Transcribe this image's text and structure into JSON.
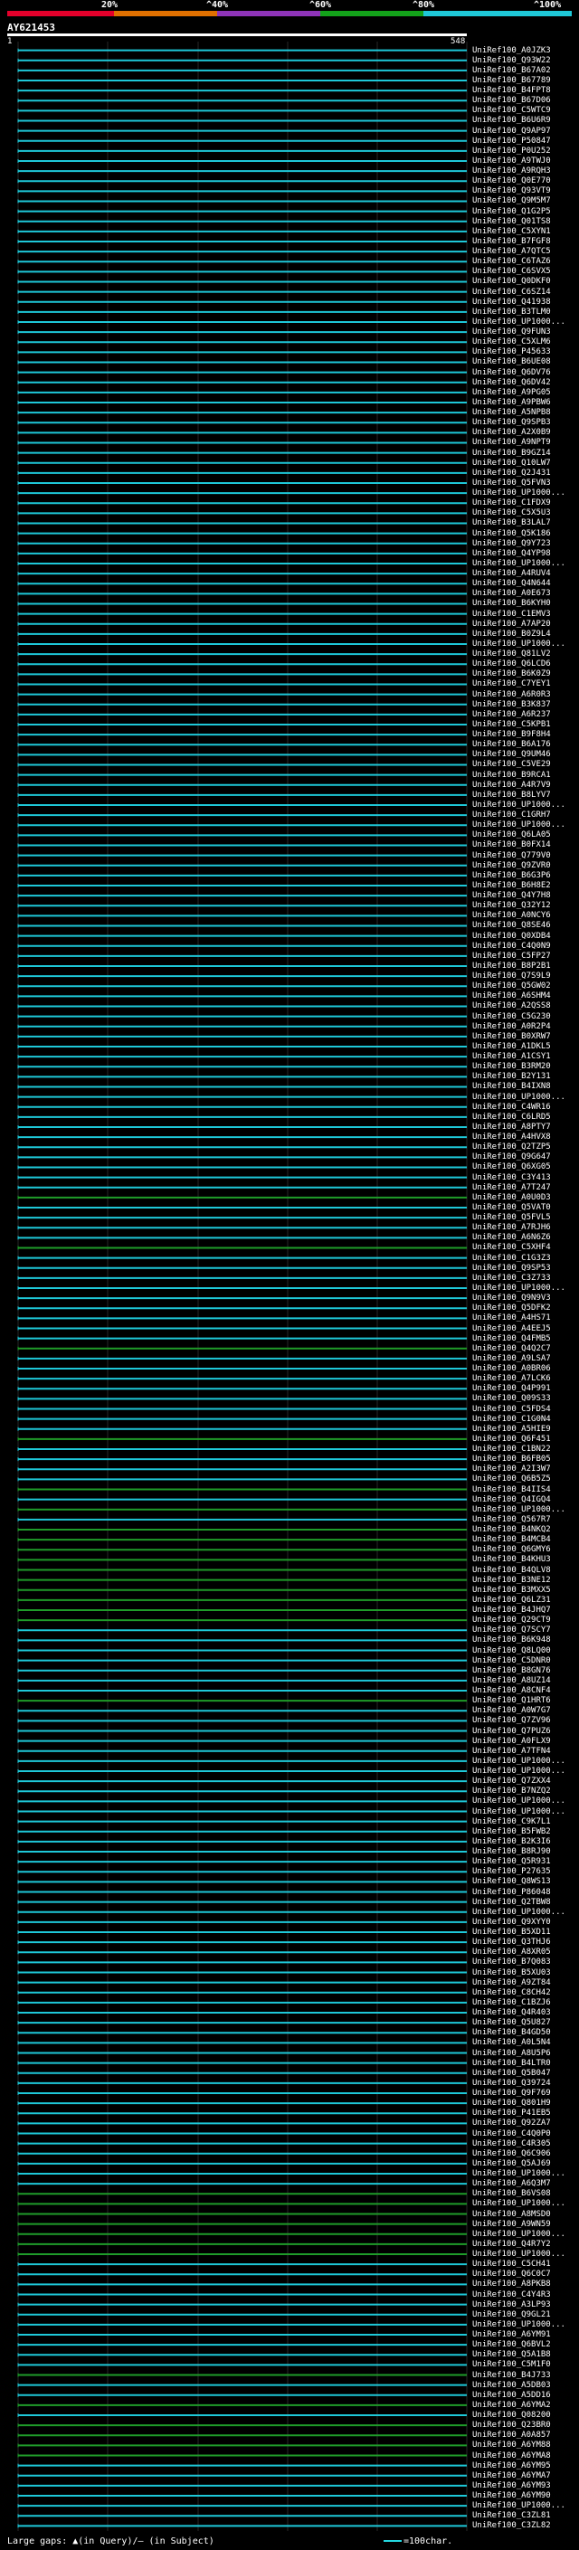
{
  "header": {
    "scale_labels": [
      "20%",
      "^40%",
      "^60%",
      "^80%",
      "^100%"
    ],
    "scale_colors": [
      "#e4002b",
      "#e07000",
      "#8e34b8",
      "#13a21a",
      "#1fc8d8"
    ],
    "query_name": "AY621453",
    "query_start": "1",
    "query_end": "548"
  },
  "colors": {
    "cyan": "#1ec8d8",
    "green": "#1f9c2a",
    "grid": "#8a8a8a"
  },
  "legend": {
    "gaps_label": "Large gaps: ▲(in Query)/— (in Subject)",
    "scale_label": "=100char."
  },
  "hits": [
    {
      "label": "UniRef100_A0JZK3",
      "color": "cyan"
    },
    {
      "label": "UniRef100_Q93W22",
      "color": "cyan"
    },
    {
      "label": "UniRef100_B67A02",
      "color": "cyan"
    },
    {
      "label": "UniRef100_B67789",
      "color": "cyan"
    },
    {
      "label": "UniRef100_B4FPT8",
      "color": "cyan"
    },
    {
      "label": "UniRef100_B67D06",
      "color": "cyan"
    },
    {
      "label": "UniRef100_C5WTC9",
      "color": "cyan"
    },
    {
      "label": "UniRef100_B6U6R9",
      "color": "cyan"
    },
    {
      "label": "UniRef100_Q9AP97",
      "color": "cyan"
    },
    {
      "label": "UniRef100_P50847",
      "color": "cyan"
    },
    {
      "label": "UniRef100_P0U252",
      "color": "cyan"
    },
    {
      "label": "UniRef100_A9TWJ0",
      "color": "cyan"
    },
    {
      "label": "UniRef100_A9RQH3",
      "color": "cyan"
    },
    {
      "label": "UniRef100_Q0E770",
      "color": "cyan"
    },
    {
      "label": "UniRef100_Q93VT9",
      "color": "cyan"
    },
    {
      "label": "UniRef100_Q9M5M7",
      "color": "cyan"
    },
    {
      "label": "UniRef100_Q1G2P5",
      "color": "cyan"
    },
    {
      "label": "UniRef100_Q01TS8",
      "color": "cyan"
    },
    {
      "label": "UniRef100_C5XYN1",
      "color": "cyan"
    },
    {
      "label": "UniRef100_B7FGF8",
      "color": "cyan"
    },
    {
      "label": "UniRef100_A7QTC5",
      "color": "cyan"
    },
    {
      "label": "UniRef100_C6TAZ6",
      "color": "cyan"
    },
    {
      "label": "UniRef100_C6SVX5",
      "color": "cyan"
    },
    {
      "label": "UniRef100_Q0DKF0",
      "color": "cyan"
    },
    {
      "label": "UniRef100_C6SZ14",
      "color": "cyan"
    },
    {
      "label": "UniRef100_Q41938",
      "color": "cyan"
    },
    {
      "label": "UniRef100_B3TLM0",
      "color": "cyan"
    },
    {
      "label": "UniRef100_UP1000...",
      "color": "cyan"
    },
    {
      "label": "UniRef100_Q9FUN3",
      "color": "cyan"
    },
    {
      "label": "UniRef100_C5XLM6",
      "color": "cyan"
    },
    {
      "label": "UniRef100_P45633",
      "color": "cyan"
    },
    {
      "label": "UniRef100_B6UE08",
      "color": "cyan"
    },
    {
      "label": "UniRef100_Q6DV76",
      "color": "cyan"
    },
    {
      "label": "UniRef100_Q6DV42",
      "color": "cyan"
    },
    {
      "label": "UniRef100_A9PG05",
      "color": "cyan"
    },
    {
      "label": "UniRef100_A9PBW6",
      "color": "cyan"
    },
    {
      "label": "UniRef100_A5NPB8",
      "color": "cyan"
    },
    {
      "label": "UniRef100_Q9SPB3",
      "color": "cyan"
    },
    {
      "label": "UniRef100_A2X0B9",
      "color": "cyan"
    },
    {
      "label": "UniRef100_A9NPT9",
      "color": "cyan"
    },
    {
      "label": "UniRef100_B9GZ14",
      "color": "cyan"
    },
    {
      "label": "UniRef100_Q10LW7",
      "color": "cyan"
    },
    {
      "label": "UniRef100_Q2J431",
      "color": "cyan"
    },
    {
      "label": "UniRef100_Q5FVN3",
      "color": "cyan"
    },
    {
      "label": "UniRef100_UP1000...",
      "color": "cyan"
    },
    {
      "label": "UniRef100_C1FDX9",
      "color": "cyan"
    },
    {
      "label": "UniRef100_C5X5U3",
      "color": "cyan"
    },
    {
      "label": "UniRef100_B3LAL7",
      "color": "cyan"
    },
    {
      "label": "UniRef100_Q5K186",
      "color": "cyan"
    },
    {
      "label": "UniRef100_Q9Y723",
      "color": "cyan"
    },
    {
      "label": "UniRef100_Q4YP98",
      "color": "cyan"
    },
    {
      "label": "UniRef100_UP1000...",
      "color": "cyan"
    },
    {
      "label": "UniRef100_A4RUV4",
      "color": "cyan"
    },
    {
      "label": "UniRef100_Q4N644",
      "color": "cyan"
    },
    {
      "label": "UniRef100_A0E673",
      "color": "cyan"
    },
    {
      "label": "UniRef100_B6KYH0",
      "color": "cyan"
    },
    {
      "label": "UniRef100_C1EMV3",
      "color": "cyan"
    },
    {
      "label": "UniRef100_A7AP20",
      "color": "cyan"
    },
    {
      "label": "UniRef100_B0Z9L4",
      "color": "cyan"
    },
    {
      "label": "UniRef100_UP1000...",
      "color": "cyan"
    },
    {
      "label": "UniRef100_Q81LV2",
      "color": "cyan"
    },
    {
      "label": "UniRef100_Q6LCD6",
      "color": "cyan"
    },
    {
      "label": "UniRef100_B6K0Z9",
      "color": "cyan"
    },
    {
      "label": "UniRef100_C7YEY1",
      "color": "cyan"
    },
    {
      "label": "UniRef100_A6R0R3",
      "color": "cyan"
    },
    {
      "label": "UniRef100_B3K837",
      "color": "cyan"
    },
    {
      "label": "UniRef100_A6R237",
      "color": "cyan"
    },
    {
      "label": "UniRef100_C5KPB1",
      "color": "cyan"
    },
    {
      "label": "UniRef100_B9F8H4",
      "color": "cyan"
    },
    {
      "label": "UniRef100_B6A176",
      "color": "cyan"
    },
    {
      "label": "UniRef100_Q9UM46",
      "color": "cyan"
    },
    {
      "label": "UniRef100_C5VE29",
      "color": "cyan"
    },
    {
      "label": "UniRef100_B9RCA1",
      "color": "cyan"
    },
    {
      "label": "UniRef100_A4R7V9",
      "color": "cyan"
    },
    {
      "label": "UniRef100_B8LYV7",
      "color": "cyan"
    },
    {
      "label": "UniRef100_UP1000...",
      "color": "cyan"
    },
    {
      "label": "UniRef100_C1GRH7",
      "color": "cyan"
    },
    {
      "label": "UniRef100_UP1000...",
      "color": "cyan"
    },
    {
      "label": "UniRef100_Q6LA05",
      "color": "cyan"
    },
    {
      "label": "UniRef100_B0FX14",
      "color": "cyan"
    },
    {
      "label": "UniRef100_Q779V0",
      "color": "cyan"
    },
    {
      "label": "UniRef100_Q9ZVR0",
      "color": "cyan"
    },
    {
      "label": "UniRef100_B6G3P6",
      "color": "cyan"
    },
    {
      "label": "UniRef100_B6H8E2",
      "color": "cyan"
    },
    {
      "label": "UniRef100_Q4Y7H8",
      "color": "cyan"
    },
    {
      "label": "UniRef100_Q32Y12",
      "color": "cyan"
    },
    {
      "label": "UniRef100_A0NCY6",
      "color": "cyan"
    },
    {
      "label": "UniRef100_Q8SE46",
      "color": "cyan"
    },
    {
      "label": "UniRef100_Q0XDB4",
      "color": "cyan"
    },
    {
      "label": "UniRef100_C4Q0N9",
      "color": "cyan"
    },
    {
      "label": "UniRef100_C5FP27",
      "color": "cyan"
    },
    {
      "label": "UniRef100_B8P2B1",
      "color": "cyan"
    },
    {
      "label": "UniRef100_Q7S9L9",
      "color": "cyan"
    },
    {
      "label": "UniRef100_Q5GW02",
      "color": "cyan"
    },
    {
      "label": "UniRef100_A6SHM4",
      "color": "cyan"
    },
    {
      "label": "UniRef100_A2QSS8",
      "color": "cyan"
    },
    {
      "label": "UniRef100_C5G230",
      "color": "cyan"
    },
    {
      "label": "UniRef100_A0R2P4",
      "color": "cyan"
    },
    {
      "label": "UniRef100_B0XRW7",
      "color": "cyan"
    },
    {
      "label": "UniRef100_A1DKL5",
      "color": "cyan"
    },
    {
      "label": "UniRef100_A1CSY1",
      "color": "cyan"
    },
    {
      "label": "UniRef100_B3RM20",
      "color": "cyan"
    },
    {
      "label": "UniRef100_B2Y131",
      "color": "cyan"
    },
    {
      "label": "UniRef100_B4IXN8",
      "color": "cyan"
    },
    {
      "label": "UniRef100_UP1000...",
      "color": "cyan"
    },
    {
      "label": "UniRef100_C4WR16",
      "color": "cyan"
    },
    {
      "label": "UniRef100_C6LRD5",
      "color": "cyan"
    },
    {
      "label": "UniRef100_A8PTY7",
      "color": "cyan"
    },
    {
      "label": "UniRef100_A4HVX8",
      "color": "cyan"
    },
    {
      "label": "UniRef100_Q2TZP5",
      "color": "cyan"
    },
    {
      "label": "UniRef100_Q9G647",
      "color": "cyan"
    },
    {
      "label": "UniRef100_Q6XG05",
      "color": "cyan"
    },
    {
      "label": "UniRef100_C3Y413",
      "color": "cyan"
    },
    {
      "label": "UniRef100_A7T247",
      "color": "cyan"
    },
    {
      "label": "UniRef100_A0U0D3",
      "color": "green"
    },
    {
      "label": "UniRef100_Q5VAT0",
      "color": "cyan"
    },
    {
      "label": "UniRef100_Q5FVL5",
      "color": "cyan"
    },
    {
      "label": "UniRef100_A7RJH6",
      "color": "cyan"
    },
    {
      "label": "UniRef100_A6N6Z6",
      "color": "cyan"
    },
    {
      "label": "UniRef100_C5XHF4",
      "color": "green"
    },
    {
      "label": "UniRef100_C1G3Z3",
      "color": "cyan"
    },
    {
      "label": "UniRef100_Q9SP53",
      "color": "cyan"
    },
    {
      "label": "UniRef100_C3Z733",
      "color": "cyan"
    },
    {
      "label": "UniRef100_UP1000...",
      "color": "cyan"
    },
    {
      "label": "UniRef100_Q9N9V3",
      "color": "cyan"
    },
    {
      "label": "UniRef100_Q5DFK2",
      "color": "cyan"
    },
    {
      "label": "UniRef100_A4HS71",
      "color": "cyan"
    },
    {
      "label": "UniRef100_A4EEJ5",
      "color": "cyan"
    },
    {
      "label": "UniRef100_Q4FMB5",
      "color": "cyan"
    },
    {
      "label": "UniRef100_Q4Q2C7",
      "color": "green"
    },
    {
      "label": "UniRef100_A9LSA7",
      "color": "cyan"
    },
    {
      "label": "UniRef100_A0BR06",
      "color": "cyan"
    },
    {
      "label": "UniRef100_A7LCK6",
      "color": "cyan"
    },
    {
      "label": "UniRef100_Q4P991",
      "color": "cyan"
    },
    {
      "label": "UniRef100_Q09S33",
      "color": "cyan"
    },
    {
      "label": "UniRef100_C5FDS4",
      "color": "cyan"
    },
    {
      "label": "UniRef100_C1G0N4",
      "color": "cyan"
    },
    {
      "label": "UniRef100_A5HIE9",
      "color": "cyan"
    },
    {
      "label": "UniRef100_Q6F451",
      "color": "green"
    },
    {
      "label": "UniRef100_C1BN22",
      "color": "cyan"
    },
    {
      "label": "UniRef100_B6FB05",
      "color": "cyan"
    },
    {
      "label": "UniRef100_A2I3W7",
      "color": "cyan"
    },
    {
      "label": "UniRef100_Q6B5Z5",
      "color": "cyan"
    },
    {
      "label": "UniRef100_B4IIS4",
      "color": "green"
    },
    {
      "label": "UniRef100_Q4IGQ4",
      "color": "cyan"
    },
    {
      "label": "UniRef100_UP1000...",
      "color": "green"
    },
    {
      "label": "UniRef100_Q567R7",
      "color": "cyan"
    },
    {
      "label": "UniRef100_B4NKQ2",
      "color": "green"
    },
    {
      "label": "UniRef100_B4MCB4",
      "color": "green"
    },
    {
      "label": "UniRef100_Q6GMY6",
      "color": "green"
    },
    {
      "label": "UniRef100_B4KHU3",
      "color": "green"
    },
    {
      "label": "UniRef100_B4QLV8",
      "color": "green"
    },
    {
      "label": "UniRef100_B3NE12",
      "color": "green"
    },
    {
      "label": "UniRef100_B3MXX5",
      "color": "green"
    },
    {
      "label": "UniRef100_Q6LZ31",
      "color": "green"
    },
    {
      "label": "UniRef100_B4JHQ7",
      "color": "green"
    },
    {
      "label": "UniRef100_Q29CT9",
      "color": "green"
    },
    {
      "label": "UniRef100_Q7SCY7",
      "color": "cyan"
    },
    {
      "label": "UniRef100_B6K948",
      "color": "cyan"
    },
    {
      "label": "UniRef100_Q8LQ00",
      "color": "cyan"
    },
    {
      "label": "UniRef100_C5DNR0",
      "color": "cyan"
    },
    {
      "label": "UniRef100_B8GN76",
      "color": "cyan"
    },
    {
      "label": "UniRef100_A8UZ14",
      "color": "cyan"
    },
    {
      "label": "UniRef100_A8CNF4",
      "color": "cyan"
    },
    {
      "label": "UniRef100_Q1HRT6",
      "color": "green"
    },
    {
      "label": "UniRef100_A0W7G7",
      "color": "cyan"
    },
    {
      "label": "UniRef100_Q7ZV96",
      "color": "cyan"
    },
    {
      "label": "UniRef100_Q7PUZ6",
      "color": "cyan"
    },
    {
      "label": "UniRef100_A0FLX9",
      "color": "cyan"
    },
    {
      "label": "UniRef100_A7TFN4",
      "color": "cyan"
    },
    {
      "label": "UniRef100_UP1000...",
      "color": "cyan"
    },
    {
      "label": "UniRef100_UP1000...",
      "color": "cyan"
    },
    {
      "label": "UniRef100_Q7ZXX4",
      "color": "cyan"
    },
    {
      "label": "UniRef100_B7NZQ2",
      "color": "cyan"
    },
    {
      "label": "UniRef100_UP1000...",
      "color": "cyan"
    },
    {
      "label": "UniRef100_UP1000...",
      "color": "cyan"
    },
    {
      "label": "UniRef100_C9K7L1",
      "color": "cyan"
    },
    {
      "label": "UniRef100_B5FWB2",
      "color": "cyan"
    },
    {
      "label": "UniRef100_B2K3I6",
      "color": "cyan"
    },
    {
      "label": "UniRef100_B8RJ90",
      "color": "cyan"
    },
    {
      "label": "UniRef100_Q5R931",
      "color": "cyan"
    },
    {
      "label": "UniRef100_P27635",
      "color": "cyan"
    },
    {
      "label": "UniRef100_Q8WS13",
      "color": "cyan"
    },
    {
      "label": "UniRef100_P86048",
      "color": "cyan"
    },
    {
      "label": "UniRef100_Q2TBW8",
      "color": "cyan"
    },
    {
      "label": "UniRef100_UP1000...",
      "color": "cyan"
    },
    {
      "label": "UniRef100_Q9XYY0",
      "color": "cyan"
    },
    {
      "label": "UniRef100_B5XD11",
      "color": "cyan"
    },
    {
      "label": "UniRef100_Q3THJ6",
      "color": "cyan"
    },
    {
      "label": "UniRef100_A8XR05",
      "color": "cyan"
    },
    {
      "label": "UniRef100_B7Q083",
      "color": "cyan"
    },
    {
      "label": "UniRef100_B5XU03",
      "color": "cyan"
    },
    {
      "label": "UniRef100_A9ZT84",
      "color": "cyan"
    },
    {
      "label": "UniRef100_C8CH42",
      "color": "cyan"
    },
    {
      "label": "UniRef100_C1BZJ6",
      "color": "cyan"
    },
    {
      "label": "UniRef100_Q4R403",
      "color": "cyan"
    },
    {
      "label": "UniRef100_Q5U827",
      "color": "cyan"
    },
    {
      "label": "UniRef100_B4GD50",
      "color": "cyan"
    },
    {
      "label": "UniRef100_A0L5N4",
      "color": "cyan"
    },
    {
      "label": "UniRef100_A8U5P6",
      "color": "cyan"
    },
    {
      "label": "UniRef100_B4LTR0",
      "color": "cyan"
    },
    {
      "label": "UniRef100_Q5B047",
      "color": "cyan"
    },
    {
      "label": "UniRef100_Q39724",
      "color": "cyan"
    },
    {
      "label": "UniRef100_Q9F769",
      "color": "cyan"
    },
    {
      "label": "UniRef100_Q801H9",
      "color": "cyan"
    },
    {
      "label": "UniRef100_P41EB5",
      "color": "cyan"
    },
    {
      "label": "UniRef100_Q92ZA7",
      "color": "cyan"
    },
    {
      "label": "UniRef100_C4Q0P0",
      "color": "cyan"
    },
    {
      "label": "UniRef100_C4R305",
      "color": "cyan"
    },
    {
      "label": "UniRef100_Q6C906",
      "color": "cyan"
    },
    {
      "label": "UniRef100_Q5AJ69",
      "color": "cyan"
    },
    {
      "label": "UniRef100_UP1000...",
      "color": "cyan"
    },
    {
      "label": "UniRef100_A6Q3M7",
      "color": "cyan"
    },
    {
      "label": "UniRef100_B6VS08",
      "color": "green"
    },
    {
      "label": "UniRef100_UP1000...",
      "color": "green"
    },
    {
      "label": "UniRef100_A8MSD0",
      "color": "green"
    },
    {
      "label": "UniRef100_A9WN59",
      "color": "green"
    },
    {
      "label": "UniRef100_UP1000...",
      "color": "green"
    },
    {
      "label": "UniRef100_Q4R7Y2",
      "color": "green"
    },
    {
      "label": "UniRef100_UP1000...",
      "color": "green"
    },
    {
      "label": "UniRef100_C5CH41",
      "color": "cyan"
    },
    {
      "label": "UniRef100_Q6C0C7",
      "color": "cyan"
    },
    {
      "label": "UniRef100_A8PKB8",
      "color": "cyan"
    },
    {
      "label": "UniRef100_C4Y4R3",
      "color": "cyan"
    },
    {
      "label": "UniRef100_A3LP93",
      "color": "cyan"
    },
    {
      "label": "UniRef100_Q9GL21",
      "color": "cyan"
    },
    {
      "label": "UniRef100_UP1000...",
      "color": "cyan"
    },
    {
      "label": "UniRef100_A6YM91",
      "color": "cyan"
    },
    {
      "label": "UniRef100_Q6BVL2",
      "color": "cyan"
    },
    {
      "label": "UniRef100_Q5A1B8",
      "color": "cyan"
    },
    {
      "label": "UniRef100_C5M1F0",
      "color": "cyan"
    },
    {
      "label": "UniRef100_B4J733",
      "color": "green"
    },
    {
      "label": "UniRef100_A5DB03",
      "color": "cyan"
    },
    {
      "label": "UniRef100_A5DD16",
      "color": "cyan"
    },
    {
      "label": "UniRef100_A6YMA2",
      "color": "green"
    },
    {
      "label": "UniRef100_Q08200",
      "color": "cyan"
    },
    {
      "label": "UniRef100_Q23BR0",
      "color": "green"
    },
    {
      "label": "UniRef100_A0A857",
      "color": "green"
    },
    {
      "label": "UniRef100_A6YM88",
      "color": "green"
    },
    {
      "label": "UniRef100_A6YMA8",
      "color": "green"
    },
    {
      "label": "UniRef100_A6YM95",
      "color": "cyan"
    },
    {
      "label": "UniRef100_A6YMA7",
      "color": "cyan"
    },
    {
      "label": "UniRef100_A6YM93",
      "color": "cyan"
    },
    {
      "label": "UniRef100_A6YM90",
      "color": "cyan"
    },
    {
      "label": "UniRef100_UP1000...",
      "color": "cyan"
    },
    {
      "label": "UniRef100_C3ZL81",
      "color": "cyan"
    },
    {
      "label": "UniRef100_C3ZL82",
      "color": "cyan"
    }
  ]
}
